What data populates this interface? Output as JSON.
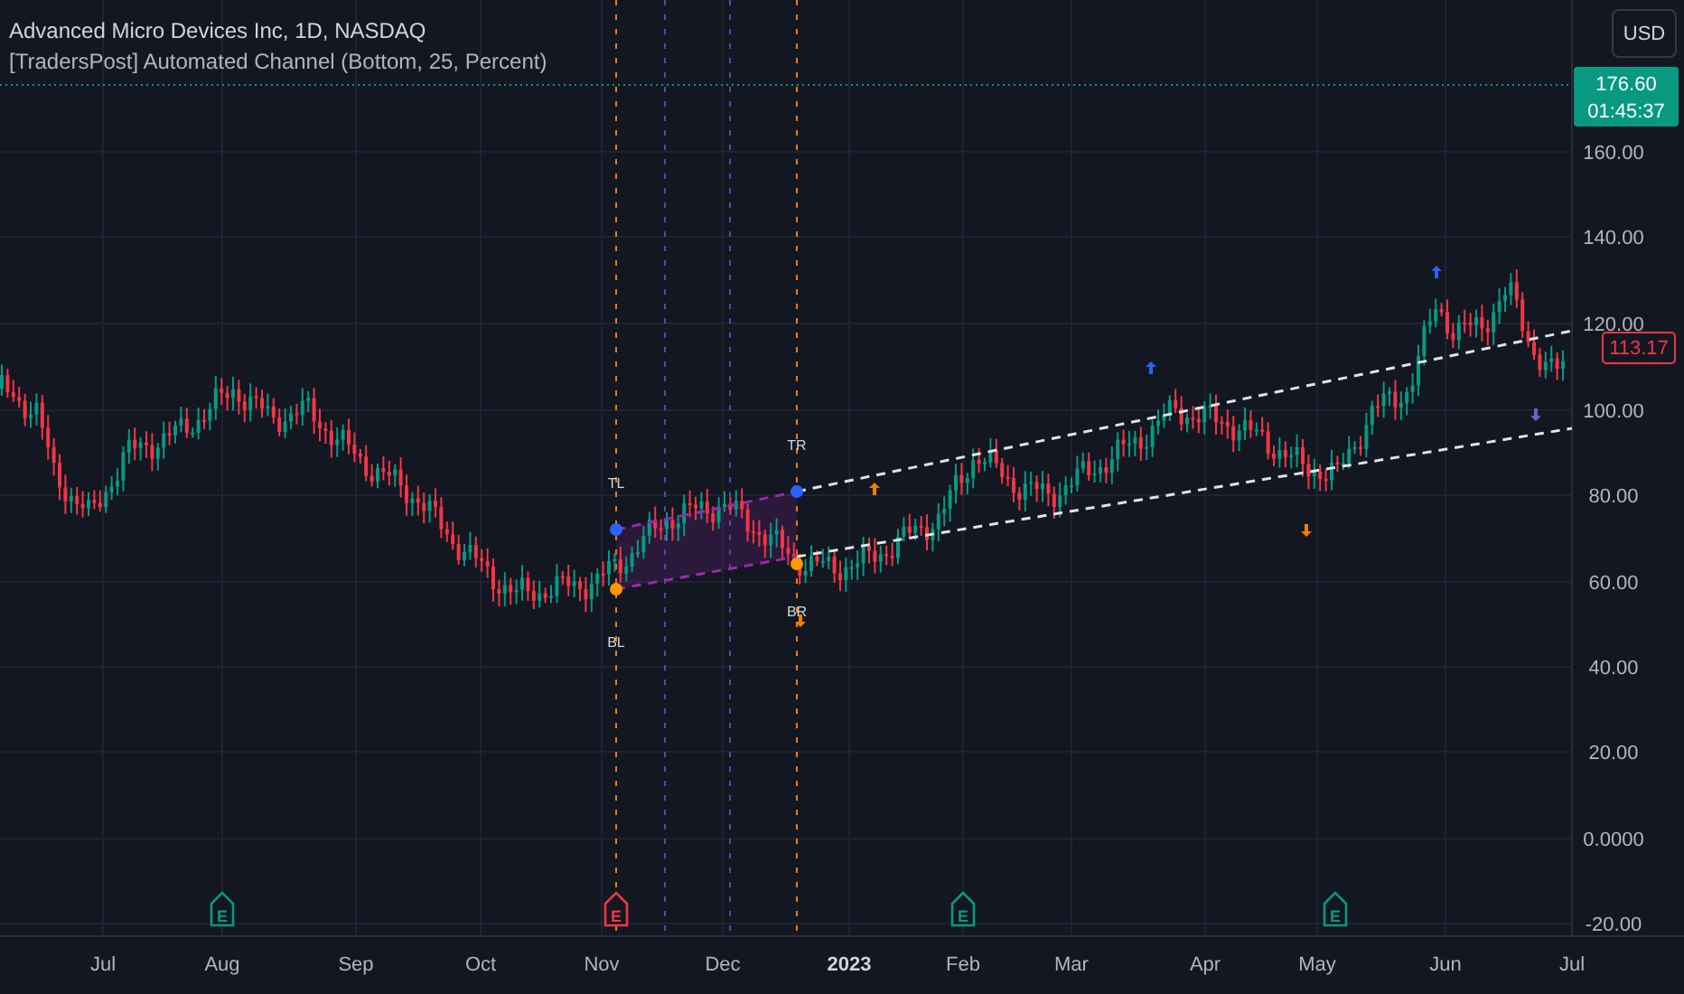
{
  "header": {
    "symbol_title": "Advanced Micro Devices Inc, 1D, NASDAQ",
    "indicator_title": "[TradersPost] Automated Channel (Bottom, 25, Percent)"
  },
  "currency_button": {
    "label": "USD"
  },
  "last_price_tag": {
    "price": "176.60",
    "countdown": "01:45:37"
  },
  "current_price_tag": {
    "price": "113.17"
  },
  "price_axis": {
    "labels": [
      "160.00",
      "140.00",
      "120.00",
      "100.00",
      "80.00",
      "60.00",
      "40.00",
      "20.00",
      "0.0000",
      "-20.00"
    ]
  },
  "time_axis": {
    "labels": [
      {
        "label": "Jul",
        "bold": false
      },
      {
        "label": "Aug",
        "bold": false
      },
      {
        "label": "Sep",
        "bold": false
      },
      {
        "label": "Oct",
        "bold": false
      },
      {
        "label": "Nov",
        "bold": false
      },
      {
        "label": "Dec",
        "bold": false
      },
      {
        "label": "2023",
        "bold": true
      },
      {
        "label": "Feb",
        "bold": false
      },
      {
        "label": "Mar",
        "bold": false
      },
      {
        "label": "Apr",
        "bold": false
      },
      {
        "label": "May",
        "bold": false
      },
      {
        "label": "Jun",
        "bold": false
      },
      {
        "label": "Jul",
        "bold": false
      }
    ]
  },
  "channel_labels": [
    "TL",
    "TR",
    "BL",
    "BR"
  ],
  "signals": [
    {
      "kind": "up",
      "color": "#f57c00"
    },
    {
      "kind": "up",
      "color": "#2962ff"
    },
    {
      "kind": "down",
      "color": "#f57c00"
    },
    {
      "kind": "up",
      "color": "#2962ff"
    },
    {
      "kind": "down",
      "color": "#7e57c2"
    },
    {
      "kind": "down",
      "color": "#f57c00"
    }
  ],
  "earnings": [
    {
      "label": "E",
      "color": "#089981"
    },
    {
      "label": "E",
      "color": "#f23645"
    },
    {
      "label": "E",
      "color": "#089981"
    },
    {
      "label": "E",
      "color": "#089981"
    }
  ]
}
